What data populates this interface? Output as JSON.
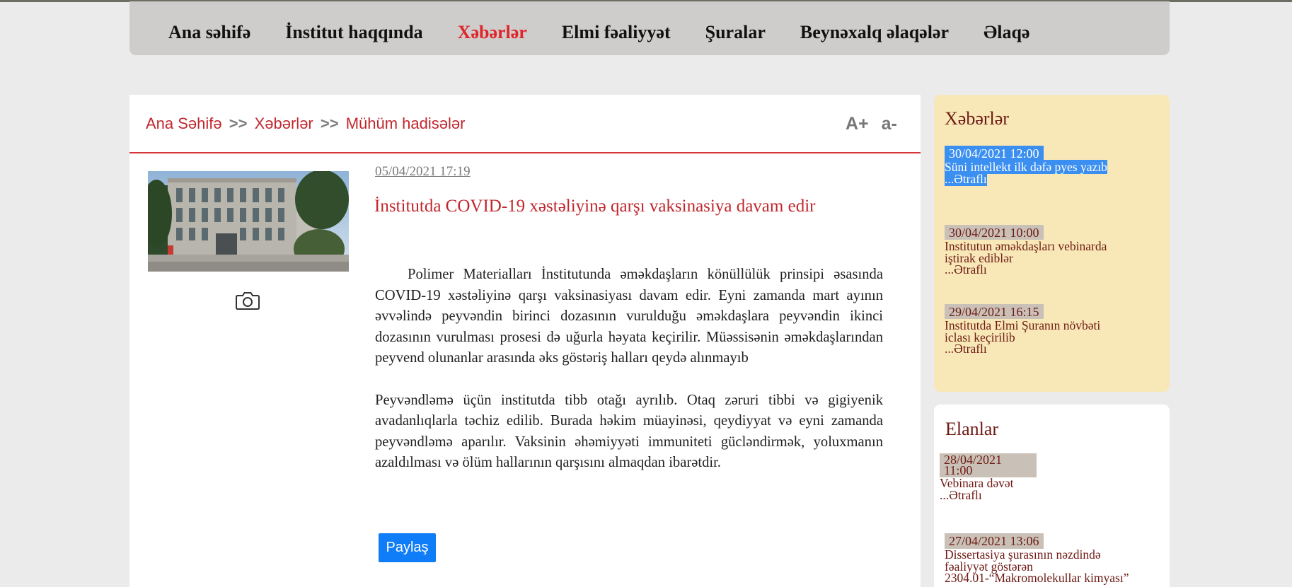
{
  "nav": {
    "items": [
      "Ana səhifə",
      "İnstitut haqqında",
      "Xəbərlər",
      "Elmi fəaliyyət",
      "Şuralar",
      "Beynəxalq əlaqələr",
      "Əlaqə"
    ],
    "active_index": 2
  },
  "breadcrumb": {
    "home": "Ana Səhifə",
    "separator": ">>",
    "section": "Xəbərlər",
    "current": "Mühüm hadisələr"
  },
  "font_controls": {
    "increase": "A+",
    "decrease": "a-"
  },
  "article": {
    "date": " 05/04/2021 17:19 ",
    "title": "İnstitutda COVID-19 xəstəliyinə qarşı vaksinasiya davam edir",
    "paragraphs": [
      "Polimer Materialları İnstitutunda əməkdaşların könüllülük prinsipi əsasında COVID-19 xəstəliyinə qarşı vaksinasiyası davam edir. Eyni zamanda mart  ayının əvvəlində peyvəndin birinci dozasının vurulduğu əməkdaşlara peyvəndin ikinci dozasının vurulması prosesi də uğurla həyata keçirilir. Müəssisənin əməkdaşlarından peyvend olunanlar arasında əks göstəriş halları qeydə alınmayıb",
      "Peyvəndləmə üçün institutda tibb otağı ayrılıb. Otaq zəruri tibbi və gigiyenik avadanlıqlarla təchiz edilib. Burada həkim müayinəsi, qeydiyyat və eyni zamanda peyvəndləmə aparılır. Vaksinin əhəmiyyəti immuniteti gücləndirmək, yoluxmanın azaldılması və ölüm hallarının qarşısını almaqdan ibarətdir."
    ],
    "share_label": "Paylaş"
  },
  "news": {
    "heading": "Xəbərlər",
    "items": [
      {
        "date": "30/04/2021 12:00",
        "title": "Süni intellekt ilk dəfə pyes yazıb",
        "more": "...Ətraflı"
      },
      {
        "date": "30/04/2021 10:00",
        "title": "Institutun əməkdaşları vebinarda iştirak ediblər",
        "more": "...Ətraflı"
      },
      {
        "date": "29/04/2021 16:15",
        "title": "Institutda Elmi Şuranın növbəti iclası keçirilib",
        "more": "...Ətraflı"
      }
    ]
  },
  "announcements": {
    "heading": "Elanlar",
    "items": [
      {
        "date": "28/04/2021 11:00",
        "title": "Vebinara dəvət",
        "more": "...Ətraflı"
      },
      {
        "date": "27/04/2021 13:06",
        "title": "Dissertasiya şurasının nəzdində fəaliyyət göstərən 2304.01-“Makromolekullar kimyası”",
        "more": ""
      }
    ]
  },
  "colors": {
    "accent_red": "#c1272d",
    "nav_active": "#e0252a",
    "sidebar_text": "#6e1a14",
    "news_box_bg": "#f8e8b7",
    "share_button": "#0f7df7",
    "selection": "#3b8ff0"
  },
  "icons": {
    "photo_gallery": "camera-icon"
  }
}
